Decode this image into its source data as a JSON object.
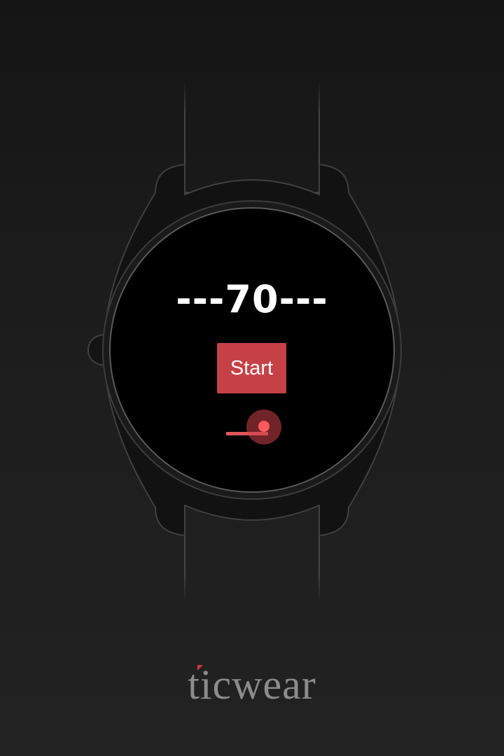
{
  "watch": {
    "counter_text": "---70---",
    "start_button_label": "Start",
    "slider": {
      "value_fraction": 0.9,
      "active_color": "#ff5a60"
    }
  },
  "brand": {
    "logo_text": "ticwear",
    "accent_color": "#d33a3a"
  },
  "colors": {
    "button_bg": "#c64146",
    "frame_outline": "#3c3c3c",
    "background": "#1d1d1d"
  }
}
